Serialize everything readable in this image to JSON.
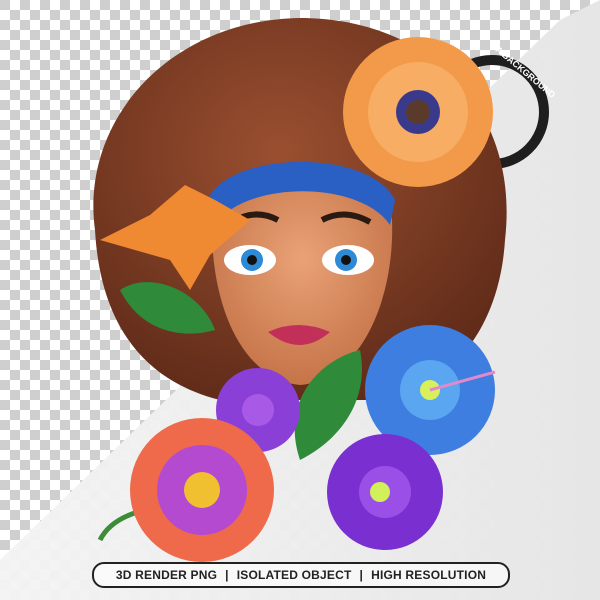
{
  "badge": {
    "text": "A BACKGROUND"
  },
  "banner": {
    "items": [
      "3D RENDER PNG",
      "ISOLATED OBJECT",
      "HIGH RESOLUTION"
    ],
    "separator": "|"
  },
  "colors": {
    "hair": "#7a3a22",
    "skin": "#d98a5c",
    "headband": "#2a5fc4",
    "orange_flower": "#f29a4a",
    "purple_flower": "#8a3fd6",
    "blue_flower": "#3d7ee0"
  }
}
